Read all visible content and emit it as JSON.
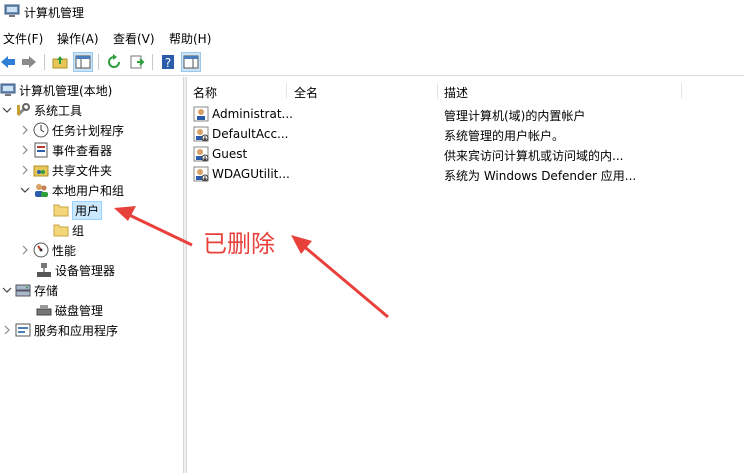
{
  "window": {
    "title": "计算机管理"
  },
  "menu": [
    {
      "label": "文件(F)"
    },
    {
      "label": "操作(A)"
    },
    {
      "label": "查看(V)"
    },
    {
      "label": "帮助(H)"
    }
  ],
  "tree": {
    "root": "计算机管理(本地)",
    "system_tools": "系统工具",
    "task_scheduler": "任务计划程序",
    "event_viewer": "事件查看器",
    "shared_folders": "共享文件夹",
    "local_users_groups": "本地用户和组",
    "users": "用户",
    "groups": "组",
    "performance": "性能",
    "device_manager": "设备管理器",
    "storage": "存储",
    "disk_management": "磁盘管理",
    "services_apps": "服务和应用程序"
  },
  "columns": {
    "name": "名称",
    "full_name": "全名",
    "description": "描述"
  },
  "users": [
    {
      "name": "Administrat...",
      "description": "管理计算机(域)的内置帐户"
    },
    {
      "name": "DefaultAcc...",
      "description": "系统管理的用户帐户。"
    },
    {
      "name": "Guest",
      "description": "供来宾访问计算机或访问域的内..."
    },
    {
      "name": "WDAGUtilit...",
      "description": "系统为 Windows Defender 应用..."
    }
  ],
  "annotation": {
    "text": "已删除",
    "color": "#e8413c"
  }
}
